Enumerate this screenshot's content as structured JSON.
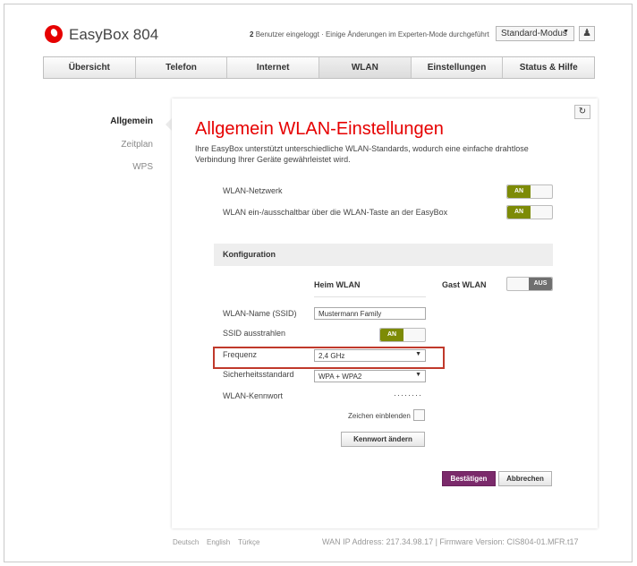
{
  "header": {
    "brand": "EasyBox 804",
    "user_count": "2",
    "user_text": "Benutzer eingeloggt · Einige Änderungen im Experten-Mode durchgeführt",
    "mode": "Standard-Modus"
  },
  "tabs": [
    {
      "label": "Übersicht"
    },
    {
      "label": "Telefon"
    },
    {
      "label": "Internet"
    },
    {
      "label": "WLAN"
    },
    {
      "label": "Einstellungen"
    },
    {
      "label": "Status & Hilfe"
    }
  ],
  "active_tab": "WLAN",
  "sidebar": {
    "items": [
      {
        "label": "Allgemein"
      },
      {
        "label": "Zeitplan"
      },
      {
        "label": "WPS"
      }
    ]
  },
  "main": {
    "title": "Allgemein WLAN-Einstellungen",
    "description": "Ihre EasyBox unterstützt unterschiedliche WLAN-Standards, wodurch eine einfache drahtlose Verbindung Ihrer Geräte gewährleistet wird.",
    "wlan_network_label": "WLAN-Netzwerk",
    "wlan_network_state": "AN",
    "wlan_button_label": "WLAN ein-/ausschaltbar über die WLAN-Taste an der EasyBox",
    "wlan_button_state": "AN",
    "config_heading": "Konfiguration",
    "col_home": "Heim WLAN",
    "col_guest": "Gast WLAN",
    "guest_state": "AUS",
    "ssid_label": "WLAN-Name (SSID)",
    "ssid_value": "Mustermann Family",
    "broadcast_label": "SSID ausstrahlen",
    "broadcast_state": "AN",
    "frequency_label": "Frequenz",
    "frequency_value": "2,4 GHz",
    "security_label": "Sicherheitsstandard",
    "security_value": "WPA + WPA2",
    "password_label": "WLAN-Kennwort",
    "password_value": "········",
    "show_chars_label": "Zeichen einblenden",
    "change_password_button": "Kennwort ändern",
    "confirm_button": "Bestätigen",
    "cancel_button": "Abbrechen"
  },
  "footer": {
    "languages": [
      "Deutsch",
      "English",
      "Türkçe"
    ],
    "status": "WAN IP Address: 217.34.98.17 | Firmware Version: CIS804-01.MFR.t17"
  },
  "colors": {
    "accent": "#e60000",
    "toggle_on": "#7d8b06",
    "primary_button": "#7b2a6b",
    "highlight_box": "#c0392b"
  }
}
